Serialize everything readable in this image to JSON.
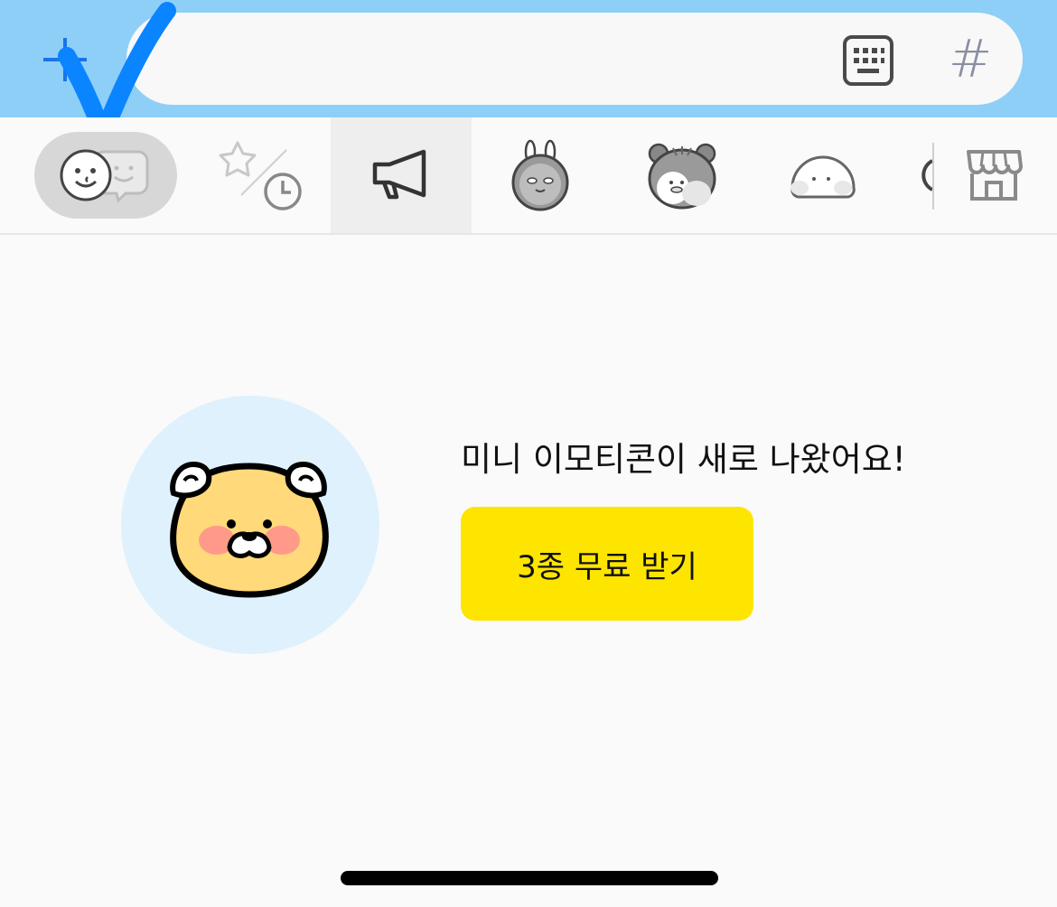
{
  "input_bar": {
    "add_icon": "plus-icon",
    "keyboard_icon": "keyboard-icon",
    "hashtag_label": "#"
  },
  "tabs": [
    {
      "name": "emoticon",
      "icon": "emoji-face-icon",
      "selected": true
    },
    {
      "name": "recent",
      "icon": "star-clock-icon"
    },
    {
      "name": "notice",
      "icon": "megaphone-icon"
    },
    {
      "name": "rabbit-pack",
      "icon": "rabbit-icon"
    },
    {
      "name": "bear-pack",
      "icon": "bear-icon"
    },
    {
      "name": "ghost-pack",
      "icon": "ghost-icon"
    },
    {
      "name": "store",
      "icon": "store-icon"
    }
  ],
  "promo": {
    "message": "미니 이모티콘이 새로 나왔어요!",
    "button_label": "3종 무료 받기",
    "character_icon": "lion-character-icon"
  },
  "colors": {
    "top_bar": "#8ecff7",
    "button": "#fee500",
    "circle": "#dff1fd",
    "check_mark": "#0a84ff"
  }
}
